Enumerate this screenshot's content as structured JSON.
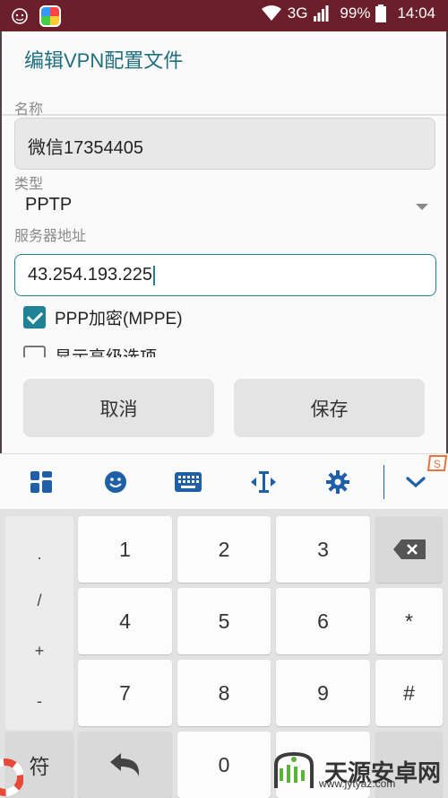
{
  "status_bar": {
    "network": "3G",
    "battery": "99%",
    "time": "14:04"
  },
  "dialog": {
    "title": "编辑VPN配置文件",
    "name_label": "名称",
    "name_value": "微信17354405",
    "type_label": "类型",
    "type_value": "PPTP",
    "server_label": "服务器地址",
    "server_value": "43.254.193.225",
    "ppp_checkbox_label": "PPP加密(MPPE)",
    "ppp_checked": true,
    "advanced_label": "显示高级选项",
    "cancel_label": "取消",
    "save_label": "保存"
  },
  "keyboard": {
    "toolbar_icons": [
      "grid-icon",
      "emoji-icon",
      "keyboard-icon",
      "cursor-icon",
      "gear-icon",
      "collapse-icon"
    ],
    "symbols": [
      ".",
      "/",
      "+",
      "-"
    ],
    "keys": {
      "k1": "1",
      "k2": "2",
      "k3": "3",
      "k4": "4",
      "k5": "5",
      "k6": "6",
      "k7": "7",
      "k8": "8",
      "k9": "9",
      "k0": "0",
      "star": "*",
      "hash": "#",
      "symbols_key": "符"
    }
  },
  "watermark": {
    "brand": "天源安卓网",
    "url": "www.jytyaz.com"
  },
  "colors": {
    "status_bar": "#6b1f2b",
    "accent": "#1f8396",
    "toolbar_icon": "#1f5fa8"
  }
}
